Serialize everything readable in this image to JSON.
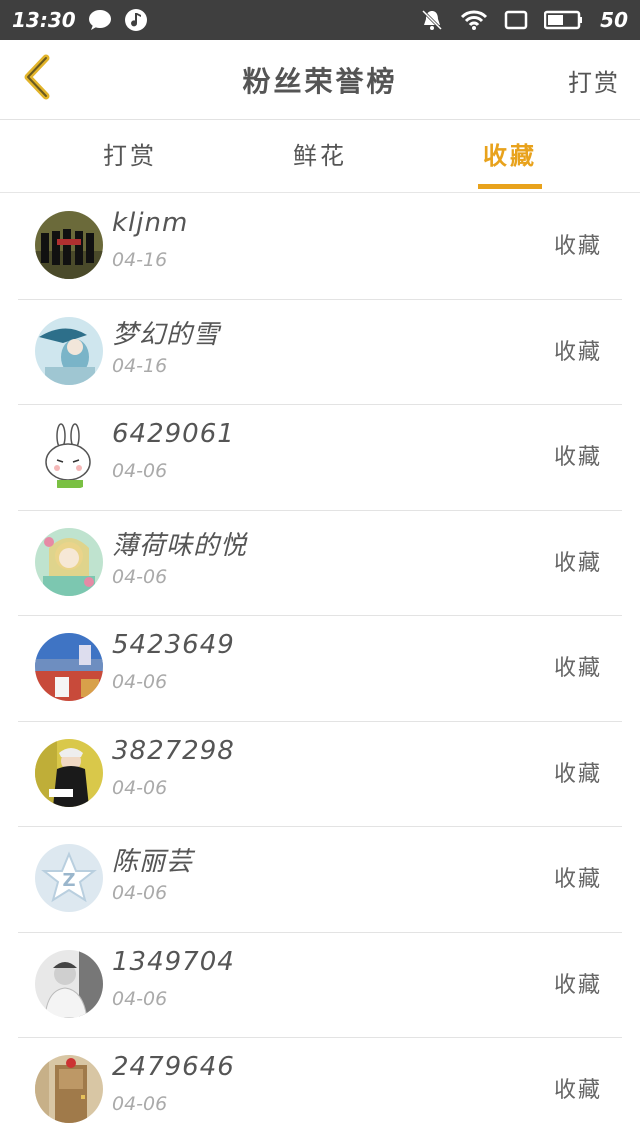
{
  "status_bar": {
    "time": "13:30",
    "battery": "50",
    "icons": [
      "chat-bubble-icon",
      "music-note-icon",
      "mute-bell-icon",
      "wifi-icon",
      "square-icon",
      "battery-icon"
    ]
  },
  "header": {
    "title": "粉丝荣誉榜",
    "action_label": "打赏",
    "back_icon": "chevron-left-icon"
  },
  "tabs": [
    {
      "label": "打赏",
      "active": false
    },
    {
      "label": "鲜花",
      "active": false
    },
    {
      "label": "收藏",
      "active": true
    }
  ],
  "colors": {
    "accent": "#e8a21c",
    "statusbar": "#3f3f3f"
  },
  "fans": [
    {
      "name": "kljnm",
      "date": "04-16",
      "type": "收藏",
      "avatar": "group-photo"
    },
    {
      "name": "梦幻的雪",
      "date": "04-16",
      "type": "收藏",
      "avatar": "anime-umbrella"
    },
    {
      "name": "6429061",
      "date": "04-06",
      "type": "收藏",
      "avatar": "rabbit-cartoon"
    },
    {
      "name": "薄荷味的悦",
      "date": "04-06",
      "type": "收藏",
      "avatar": "anime-girl"
    },
    {
      "name": "5423649",
      "date": "04-06",
      "type": "收藏",
      "avatar": "city-landscape"
    },
    {
      "name": "3827298",
      "date": "04-06",
      "type": "收藏",
      "avatar": "girl-reading"
    },
    {
      "name": "陈丽芸",
      "date": "04-06",
      "type": "收藏",
      "avatar": "qq-star-logo"
    },
    {
      "name": "1349704",
      "date": "04-06",
      "type": "收藏",
      "avatar": "bw-portrait"
    },
    {
      "name": "2479646",
      "date": "04-06",
      "type": "收藏",
      "avatar": "door-photo"
    }
  ]
}
